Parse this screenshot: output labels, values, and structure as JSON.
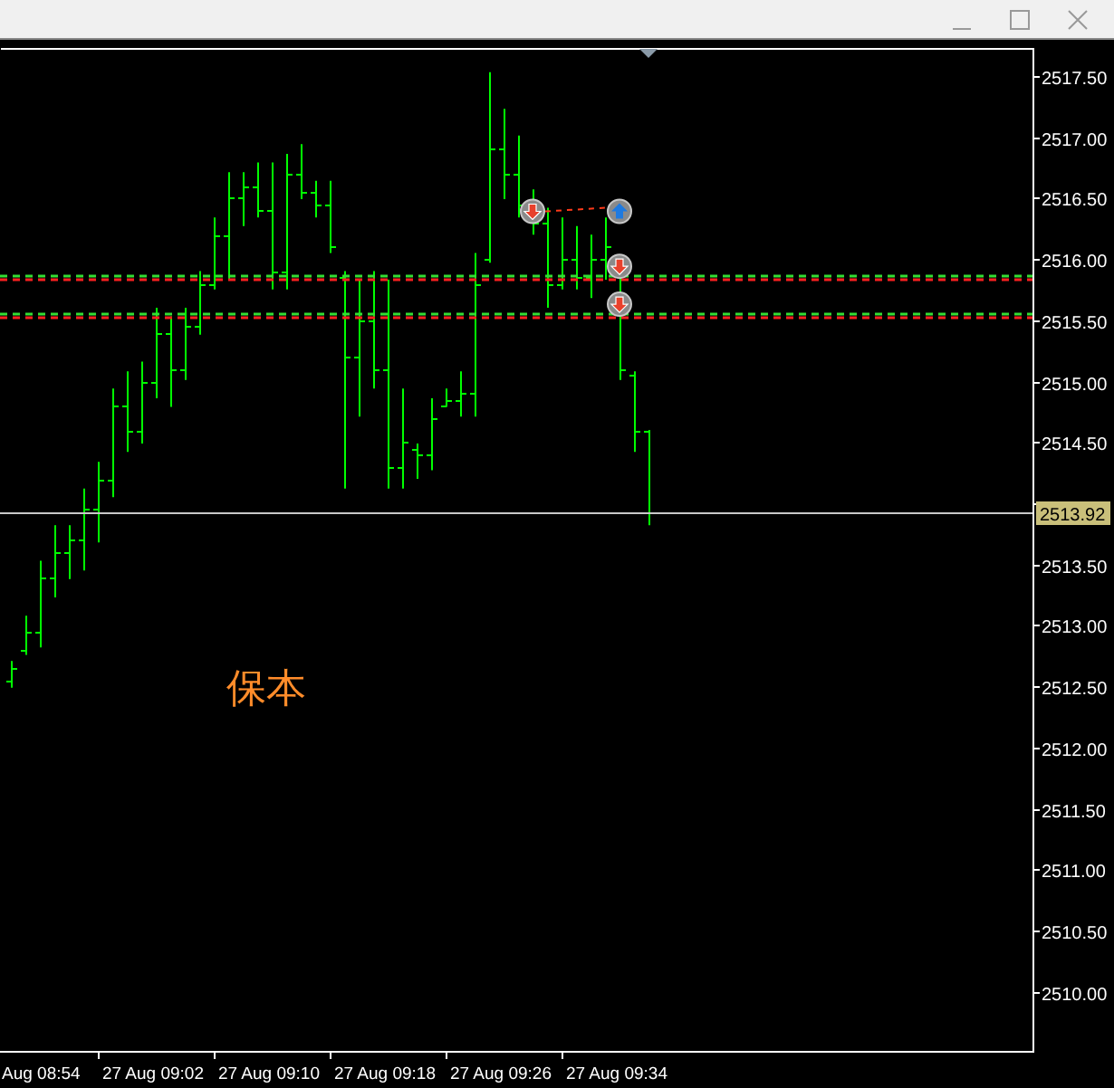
{
  "chart": {
    "price_axis_labels": [
      "2517.50",
      "2517.00",
      "2516.50",
      "2516.00",
      "2515.50",
      "2515.00",
      "2514.50",
      "2513.50",
      "2513.00",
      "2512.50",
      "2512.00",
      "2511.50",
      "2511.00",
      "2510.50",
      "2510.00"
    ],
    "time_axis_labels": [
      "Aug 08:54",
      "27 Aug 09:02",
      "27 Aug 09:10",
      "27 Aug 09:18",
      "27 Aug 09:26",
      "27 Aug 09:34"
    ],
    "price_levels": [
      {
        "color": "#33dd33"
      },
      {
        "color": "#ff2020"
      },
      {
        "color": "#33dd33"
      },
      {
        "color": "#ff2020"
      }
    ],
    "current_price": "2513.92",
    "trade_markers": [
      {
        "kind": "sell"
      },
      {
        "kind": "buy"
      },
      {
        "kind": "sell"
      },
      {
        "kind": "sell"
      }
    ],
    "annotation_text": "保本"
  }
}
